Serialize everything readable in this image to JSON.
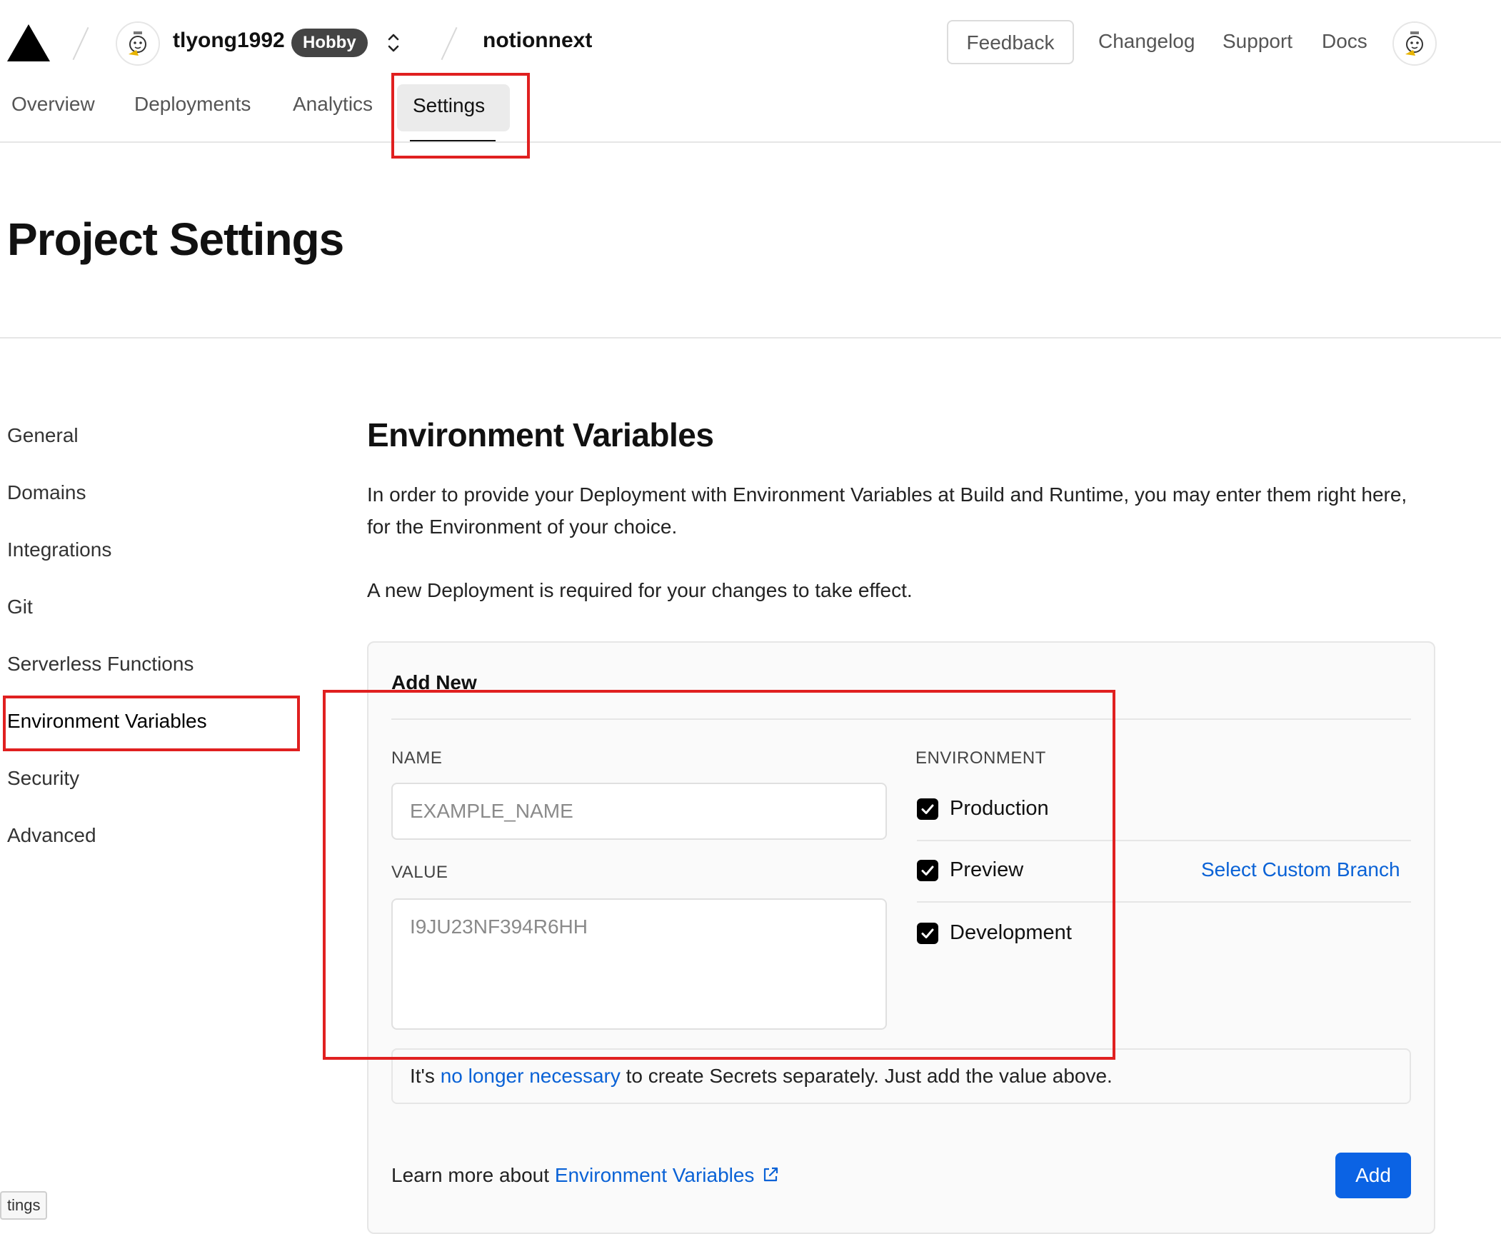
{
  "header": {
    "user_name": "tlyong1992",
    "plan_badge": "Hobby",
    "project_name": "notionnext",
    "feedback_label": "Feedback",
    "links": [
      "Changelog",
      "Support",
      "Docs"
    ]
  },
  "tabs": [
    "Overview",
    "Deployments",
    "Analytics",
    "Settings"
  ],
  "active_tab": "Settings",
  "page_title": "Project Settings",
  "sidebar": {
    "items": [
      "General",
      "Domains",
      "Integrations",
      "Git",
      "Serverless Functions",
      "Environment Variables",
      "Security",
      "Advanced"
    ],
    "active": "Environment Variables"
  },
  "main": {
    "title": "Environment Variables",
    "description_1": "In order to provide your Deployment with Environment Variables at Build and Runtime, you may enter them right here, for the Environment of your choice.",
    "description_2": "A new Deployment is required for your changes to take effect.",
    "card": {
      "heading": "Add New",
      "name_label": "NAME",
      "name_placeholder": "EXAMPLE_NAME",
      "value_label": "VALUE",
      "value_placeholder": "I9JU23NF394R6HH",
      "environment_label": "ENVIRONMENT",
      "environments": [
        {
          "label": "Production",
          "checked": true
        },
        {
          "label": "Preview",
          "checked": true
        },
        {
          "label": "Development",
          "checked": true
        }
      ],
      "custom_branch_link": "Select Custom Branch",
      "notice_prefix": "It's ",
      "notice_link": "no longer necessary",
      "notice_suffix": " to create Secrets separately. Just add the value above.",
      "learn_more_prefix": "Learn more about ",
      "learn_more_link": "Environment Variables",
      "add_button": "Add"
    }
  },
  "tooltip": "tings",
  "colors": {
    "accent_blue": "#0b63e4",
    "link_blue": "#0a62d6",
    "annotation_red": "#e02020",
    "badge_bg": "#444444"
  },
  "icons": [
    "vercel-logo-icon",
    "avatar-icon",
    "chevron-up-down-icon",
    "checkmark-icon",
    "external-link-icon"
  ]
}
